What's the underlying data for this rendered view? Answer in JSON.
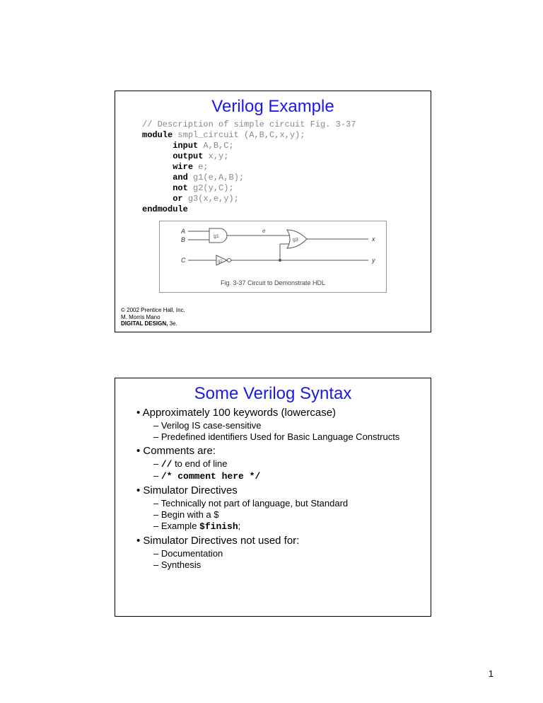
{
  "slide1": {
    "title": "Verilog Example",
    "code_comment": "// Description of simple circuit Fig. 3-37",
    "code_module_kw": "module",
    "code_module_rest": " smpl_circuit (A,B,C,x,y);",
    "code_input_kw": "input",
    "code_input_rest": " A,B,C;",
    "code_output_kw": "output",
    "code_output_rest": " x,y;",
    "code_wire_kw": "wire",
    "code_wire_rest": " e;",
    "code_and_kw": "and",
    "code_and_rest": " g1(e,A,B);",
    "code_not_kw": "not",
    "code_not_rest": " g2(y,C);",
    "code_or_kw": "or",
    "code_or_rest": " g3(x,e,y);",
    "code_end_kw": "endmodule",
    "fig_labels": {
      "A": "A",
      "B": "B",
      "C": "C",
      "e": "e",
      "x": "x",
      "y": "y",
      "g1": "g1",
      "g2": "g2",
      "g3": "g3"
    },
    "fig_caption": "Fig. 3-37  Circuit to Demonstrate HDL",
    "copy1": "© 2002 Prentice Hall, Inc.",
    "copy2": "M. Morris Mano",
    "copy3": "DIGITAL DESIGN, 3e.",
    "copy3_bold": "DIGITAL DESIGN,",
    "copy3_rest": " 3e."
  },
  "slide2": {
    "title": "Some Verilog Syntax",
    "b1": "Approximately 100 keywords (lowercase)",
    "b1a": "Verilog IS case-sensitive",
    "b1b": "Predefined identifiers Used for Basic Language Constructs",
    "b2": "Comments are:",
    "b2a_code": "//",
    "b2a_rest": " to end of line",
    "b2b_code": "/* comment here */",
    "b3": "Simulator Directives",
    "b3a": "Technically not part of language, but Standard",
    "b3b": "Begin with a $",
    "b3c_pre": "Example ",
    "b3c_code": "$finish",
    "b3c_post": ";",
    "b4": "Simulator Directives not used for:",
    "b4a": "Documentation",
    "b4b": "Synthesis"
  },
  "pagenum": "1"
}
